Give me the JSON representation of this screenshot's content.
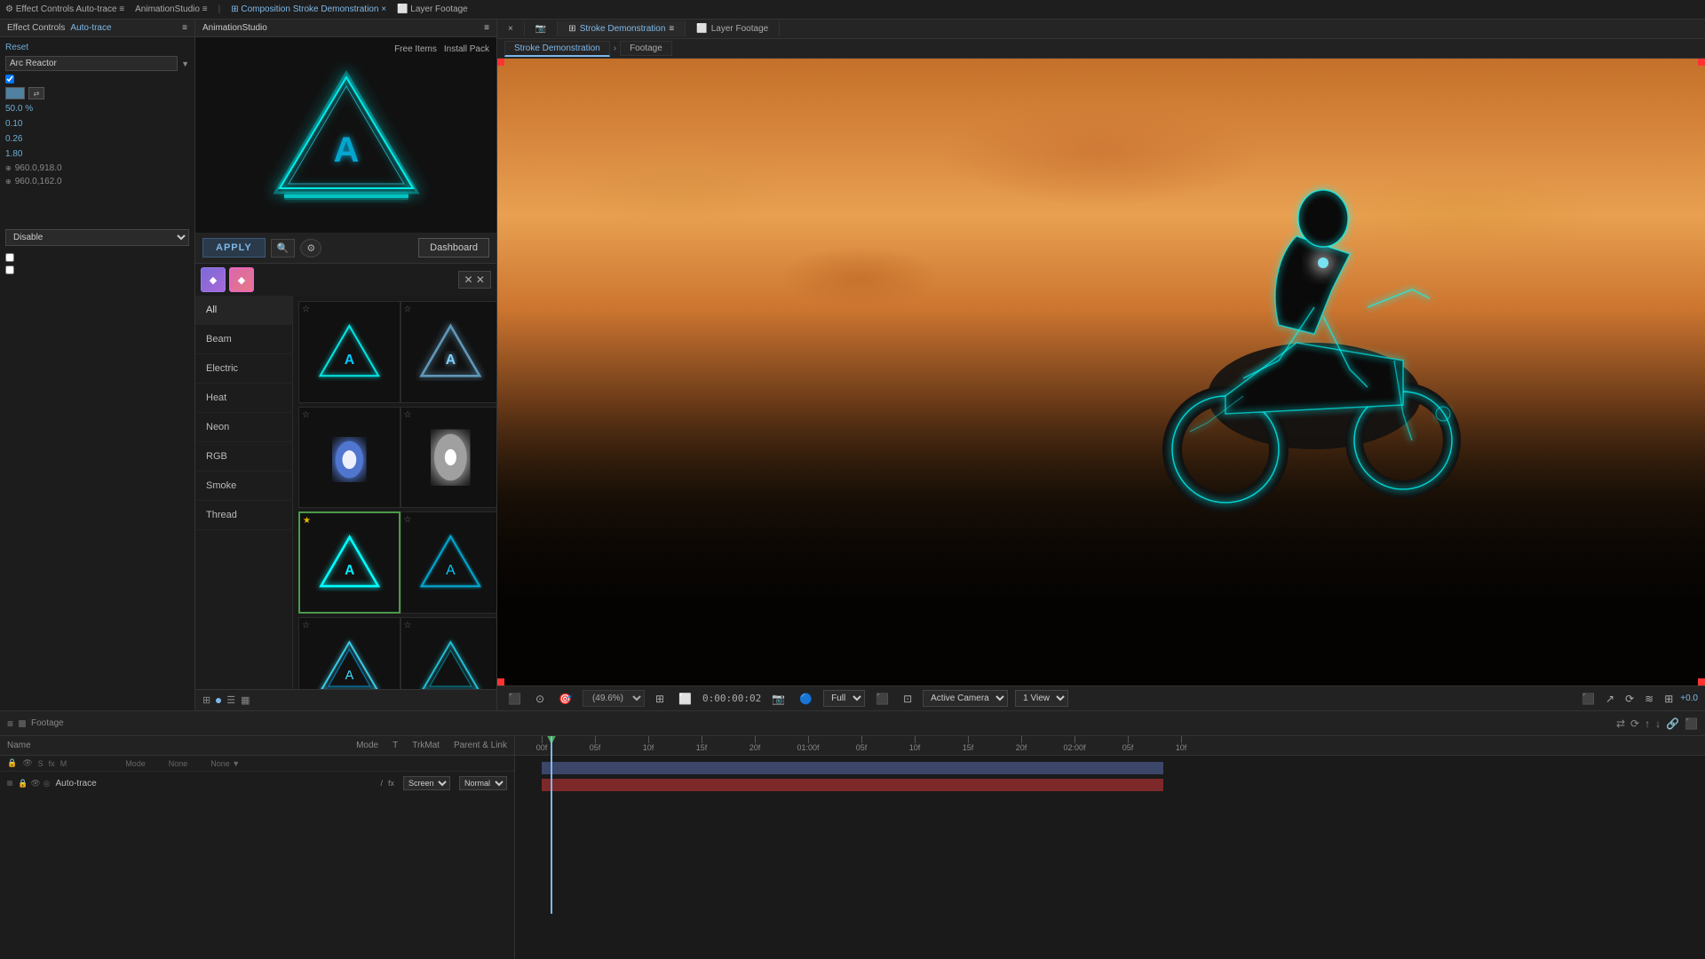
{
  "topbar": {
    "items": [
      "Effect Controls",
      "Auto-trace",
      "AnimationStudio",
      "Composition",
      "Stroke Demonstration",
      "Layer Footage"
    ]
  },
  "effectControls": {
    "title": "Effect Controls",
    "subtitle": "Auto-trace",
    "autotrace": "Auto-trace",
    "reset": "Reset",
    "preset": "Arc Reactor",
    "param1": "0.10",
    "param2": "0.26",
    "param3": "1.80",
    "pct": "50.0",
    "coord1": "960.0,918.0",
    "coord2": "960.0,162.0",
    "disable": "Disable"
  },
  "animationStudio": {
    "title": "AnimationStudio",
    "freeItems": "Free Items",
    "installPack": "Install Pack",
    "applyBtn": "APPLY",
    "dashboardBtn": "Dashboard",
    "categories": [
      {
        "id": "all",
        "label": "All"
      },
      {
        "id": "beam",
        "label": "Beam"
      },
      {
        "id": "electric",
        "label": "Electric"
      },
      {
        "id": "heat",
        "label": "Heat"
      },
      {
        "id": "neon",
        "label": "Neon"
      },
      {
        "id": "rgb",
        "label": "RGB"
      },
      {
        "id": "smoke",
        "label": "Smoke"
      },
      {
        "id": "thread",
        "label": "Thread"
      }
    ],
    "presets": [
      {
        "id": 1,
        "starred": false,
        "selected": false,
        "type": "triangle-cyan-sharp"
      },
      {
        "id": 2,
        "starred": false,
        "selected": false,
        "type": "triangle-cyan-soft"
      },
      {
        "id": 3,
        "starred": false,
        "selected": false,
        "type": "blob-glow"
      },
      {
        "id": 4,
        "starred": false,
        "selected": false,
        "type": "teardrop-glow"
      },
      {
        "id": 5,
        "starred": false,
        "selected": true,
        "type": "triangle-cyan-selected"
      },
      {
        "id": 6,
        "starred": false,
        "selected": false,
        "type": "triangle-cyan-outline"
      },
      {
        "id": 7,
        "starred": false,
        "selected": false,
        "type": "triangle-neon1"
      },
      {
        "id": 8,
        "starred": false,
        "selected": false,
        "type": "triangle-neon2"
      },
      {
        "id": 9,
        "starred": false,
        "selected": false,
        "type": "triangle-outline1"
      },
      {
        "id": 10,
        "starred": false,
        "selected": false,
        "type": "triangle-outline2"
      }
    ]
  },
  "composition": {
    "title": "Composition",
    "tabName": "Stroke Demonstration",
    "closeIcon": "×",
    "layerFootage": "Layer Footage",
    "subTabs": [
      "Stroke Demonstration",
      "Footage"
    ],
    "zoomLevel": "49.6%",
    "timecode": "0:00:00:02",
    "quality": "Full",
    "camera": "Active Camera",
    "view": "1 View",
    "plusValue": "+0.0"
  },
  "timeline": {
    "footage": "Footage",
    "columns": [
      "Name",
      "Mode",
      "T",
      "TrkMat",
      "Parent & Link"
    ],
    "modeDefault": "Screen",
    "row1": {
      "name": "Auto-trace",
      "mode": "Screen",
      "parent": "None"
    }
  },
  "ruler": {
    "marks": [
      "00f",
      "05f",
      "10f",
      "15f",
      "20f",
      "01:00f",
      "05f",
      "10f",
      "15f",
      "20f",
      "02:00f",
      "05f",
      "10f"
    ]
  }
}
